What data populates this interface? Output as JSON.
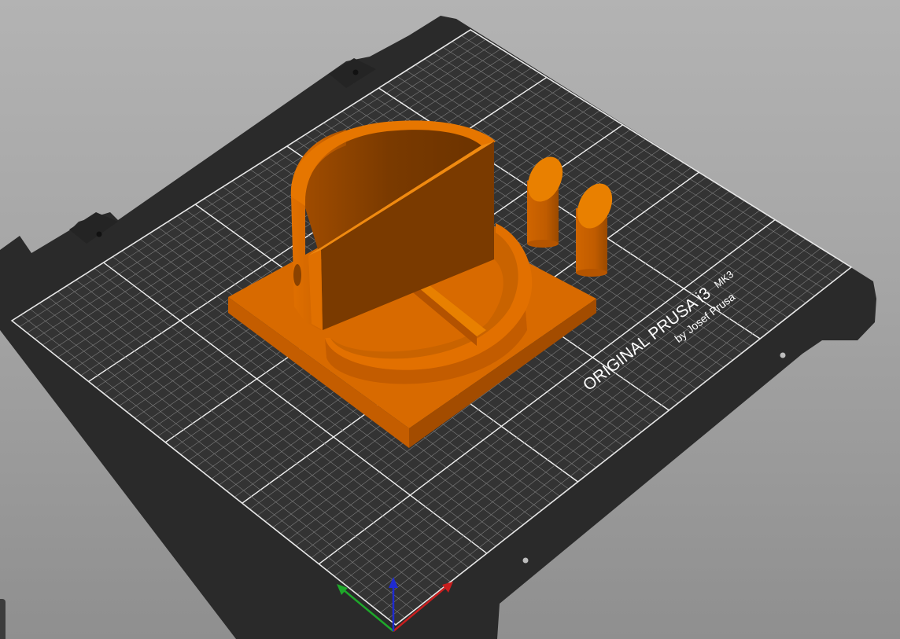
{
  "bed": {
    "brand_line1": "ORIGINAL PRUSA i3",
    "brand_model": "MK3",
    "brand_line2": "by Josef Prusa"
  },
  "colors": {
    "background_top": "#b3b3b3",
    "background_bottom": "#8f8f8f",
    "bed_sheet": "#2f2f2f",
    "bed_grid": "#ffffff",
    "model_orange": "#d86a00",
    "model_orange_shadow": "#7a3800",
    "axis_x": "#c81e1e",
    "axis_y": "#1ea82a",
    "axis_z": "#1f2bd0"
  },
  "icons": {
    "gizmo": "axes-gizmo-icon"
  }
}
